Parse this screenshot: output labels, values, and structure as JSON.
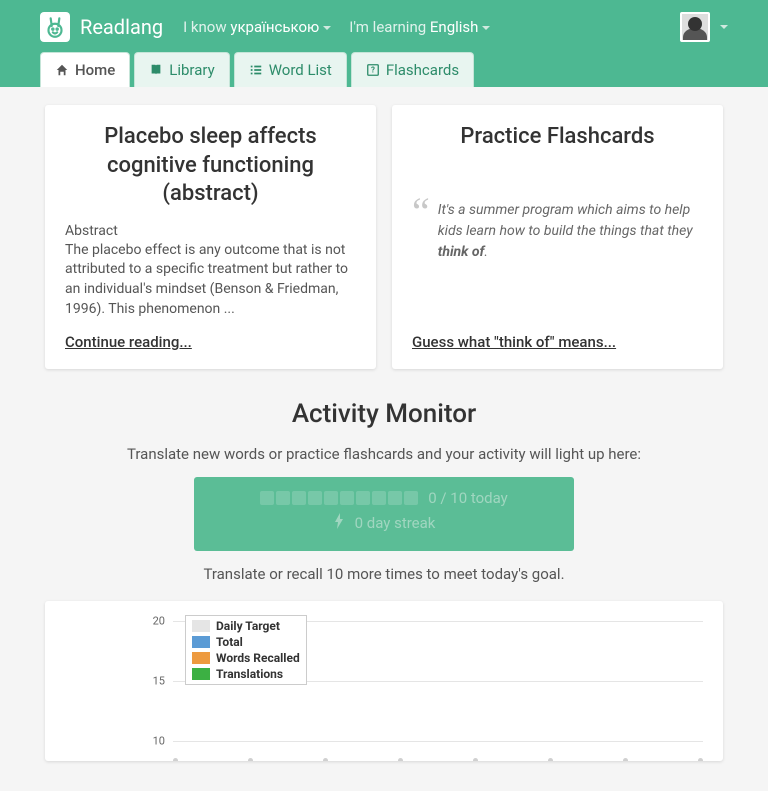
{
  "brand": "Readlang",
  "langSelectors": {
    "know_prefix": "I know ",
    "know_lang": "українською",
    "learn_prefix": "I'm learning ",
    "learn_lang": "English"
  },
  "tabs": {
    "home": "Home",
    "library": "Library",
    "wordlist": "Word List",
    "flashcards": "Flashcards"
  },
  "readingCard": {
    "title": "Placebo sleep affects cognitive functioning (abstract)",
    "abstract_label": "Abstract",
    "abstract_text": "The placebo effect is any outcome that is not attributed to a specific treatment but rather to an individual's mindset (Benson & Friedman, 1996). This phenomenon ...",
    "link": "Continue reading..."
  },
  "flashcardCard": {
    "title": "Practice Flashcards",
    "quote_before": "It's a summer program which aims to help kids learn how to build the things that they ",
    "quote_bold": "think of",
    "quote_after": ".",
    "link": "Guess what \"think of\" means..."
  },
  "activity": {
    "title": "Activity Monitor",
    "subtitle": "Translate new words or practice flashcards and your activity will light up here:",
    "progress_text": "0 / 10 today",
    "streak_text": "0 day streak",
    "goal_text": "Translate or recall 10 more times to meet today's goal."
  },
  "chart_data": {
    "type": "bar",
    "y_ticks": [
      20,
      15,
      10
    ],
    "ylim": [
      0,
      22
    ],
    "legend": [
      {
        "label": "Daily Target",
        "color": "#e5e5e5"
      },
      {
        "label": "Total",
        "color": "#5b9bd5"
      },
      {
        "label": "Words Recalled",
        "color": "#ed9a3f"
      },
      {
        "label": "Translations",
        "color": "#3cb043"
      }
    ],
    "points": 8
  }
}
